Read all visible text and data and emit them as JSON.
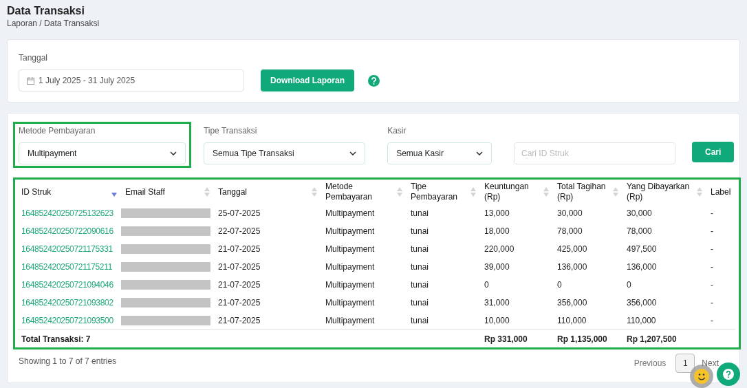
{
  "page": {
    "title": "Data Transaksi",
    "breadcrumb": "Laporan / Data Transaksi"
  },
  "date_filter": {
    "label": "Tanggal",
    "value": "1 July 2025 - 31 July 2025",
    "download_button": "Download Laporan"
  },
  "filters": [
    {
      "kind": "select",
      "label": "Metode Pembayaran",
      "value": "Multipayment",
      "highlighted": true
    },
    {
      "kind": "select",
      "label": "Tipe Transaksi",
      "value": "Semua Tipe Transaksi",
      "highlighted": false
    },
    {
      "kind": "select",
      "label": "Kasir",
      "value": "Semua Kasir",
      "highlighted": false
    },
    {
      "kind": "search",
      "placeholder": "Cari ID Struk",
      "highlighted": false
    }
  ],
  "search_button": "Cari",
  "table": {
    "highlighted": true,
    "columns": [
      {
        "label": "ID Struk",
        "sorted": true
      },
      {
        "label": "Email Staff",
        "sortable": true,
        "sorted": false
      },
      {
        "label": "Tanggal",
        "sortable": true,
        "sorted": false
      },
      {
        "label": "Metode Pembayaran",
        "sortable": true,
        "sorted": false
      },
      {
        "label": "Tipe Pembayaran",
        "sortable": true,
        "sorted": false
      },
      {
        "label": "Keuntungan (Rp)",
        "sortable": true,
        "sorted": false
      },
      {
        "label": "Total Tagihan (Rp)",
        "sortable": true,
        "sorted": false
      },
      {
        "label": "Yang Dibayarkan (Rp)",
        "sortable": true,
        "sorted": false
      },
      {
        "label": "Label",
        "sortable": false,
        "sorted": false
      }
    ],
    "rows": [
      {
        "id": "164852420250725132623",
        "date": "25-07-2025",
        "method": "Multipayment",
        "type": "tunai",
        "profit": "13,000",
        "total": "30,000",
        "paid": "30,000",
        "label": "-"
      },
      {
        "id": "164852420250722090616",
        "date": "22-07-2025",
        "method": "Multipayment",
        "type": "tunai",
        "profit": "18,000",
        "total": "78,000",
        "paid": "78,000",
        "label": "-"
      },
      {
        "id": "164852420250721175331",
        "date": "21-07-2025",
        "method": "Multipayment",
        "type": "tunai",
        "profit": "220,000",
        "total": "425,000",
        "paid": "497,500",
        "label": "-"
      },
      {
        "id": "164852420250721175211",
        "date": "21-07-2025",
        "method": "Multipayment",
        "type": "tunai",
        "profit": "39,000",
        "total": "136,000",
        "paid": "136,000",
        "label": "-"
      },
      {
        "id": "164852420250721094046",
        "date": "21-07-2025",
        "method": "Multipayment",
        "type": "tunai",
        "profit": "0",
        "total": "0",
        "paid": "0",
        "label": "-"
      },
      {
        "id": "164852420250721093802",
        "date": "21-07-2025",
        "method": "Multipayment",
        "type": "tunai",
        "profit": "31,000",
        "total": "356,000",
        "paid": "356,000",
        "label": "-"
      },
      {
        "id": "164852420250721093500",
        "date": "21-07-2025",
        "method": "Multipayment",
        "type": "tunai",
        "profit": "10,000",
        "total": "110,000",
        "paid": "110,000",
        "label": "-"
      }
    ],
    "footer": {
      "count": "Total Transaksi: 7",
      "profit": "Rp 331,000",
      "total": "Rp 1,135,000",
      "paid": "Rp 1,207,500"
    }
  },
  "entries_info": "Showing 1 to 7 of 7 entries",
  "pagination": {
    "previous": "Previous",
    "pages": [
      {
        "label": "1",
        "selected": true
      }
    ],
    "next": "Next"
  }
}
